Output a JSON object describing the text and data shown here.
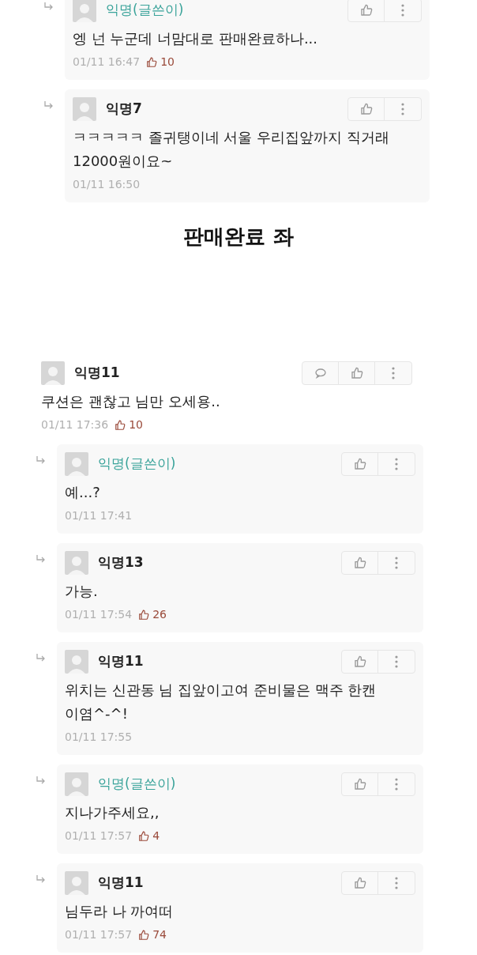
{
  "top_replies": [
    {
      "author": "익명(글쓴이)",
      "writer": true,
      "body": "엥 넌 누군데 너맘대로 판매완료하나...",
      "time": "01/11 16:47",
      "likes": "10"
    },
    {
      "author": "익명7",
      "writer": false,
      "body": "ㅋㅋㅋㅋㅋ 졸귀탱이네 서울 우리집앞까지 직거래 12000원이요~",
      "time": "01/11 16:50"
    }
  ],
  "caption": "판매완료 좌",
  "comment": {
    "author": "익명11",
    "writer": false,
    "body": "쿠션은 괜찮고 님만 오세용..",
    "time": "01/11 17:36",
    "likes": "10",
    "replies": [
      {
        "author": "익명(글쓴이)",
        "writer": true,
        "body": "예...?",
        "time": "01/11 17:41"
      },
      {
        "author": "익명13",
        "writer": false,
        "body": "가능.",
        "time": "01/11 17:54",
        "likes": "26"
      },
      {
        "author": "익명11",
        "writer": false,
        "body": "위치는 신관동 님 집앞이고여 준비물은 맥주 한캔이염^-^!",
        "time": "01/11 17:55"
      },
      {
        "author": "익명(글쓴이)",
        "writer": true,
        "body": "지나가주세요,,",
        "time": "01/11 17:57",
        "likes": "4"
      },
      {
        "author": "익명11",
        "writer": false,
        "body": "님두라 나 까여떠",
        "time": "01/11 17:57",
        "likes": "74"
      }
    ]
  }
}
